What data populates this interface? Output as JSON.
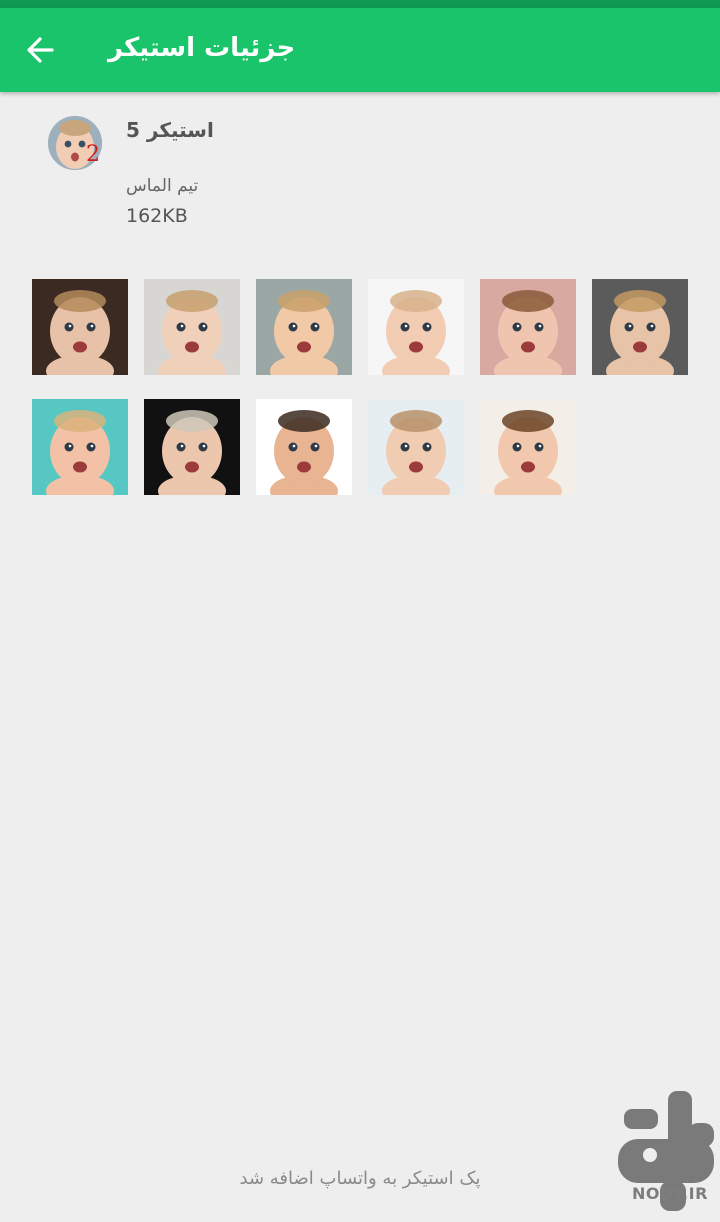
{
  "appbar": {
    "title": "جزئیات استیکر",
    "back_icon": "arrow-left-icon",
    "color": "#19c46a"
  },
  "pack": {
    "icon_badge": "2",
    "name": "استیکر 5",
    "publisher": "تیم الماس",
    "size": "162KB"
  },
  "stickers": [
    {
      "bg": "#3a2a22",
      "skin": "#e8c2a8",
      "hair": "#b48a5a"
    },
    {
      "bg": "#d8d6d2",
      "skin": "#f0d0b8",
      "hair": "#c8a070"
    },
    {
      "bg": "#9aa7a4",
      "skin": "#f1c9a6",
      "hair": "#c9a06a"
    },
    {
      "bg": "#f6f6f6",
      "skin": "#f2cdb4",
      "hair": "#d7b28a"
    },
    {
      "bg": "#d8a9a0",
      "skin": "#f0c5b0",
      "hair": "#8a5a3a"
    },
    {
      "bg": "#5b5b5b",
      "skin": "#e7c3a7",
      "hair": "#c49a63"
    },
    {
      "bg": "#56c7c2",
      "skin": "#f3c2a6",
      "hair": "#d9b27d"
    },
    {
      "bg": "#111111",
      "skin": "#ecc7ad",
      "hair": "#cfc7b8"
    },
    {
      "bg": "#ffffff",
      "skin": "#e9b491",
      "hair": "#3b2a20"
    },
    {
      "bg": "#e7eef2",
      "skin": "#f0cdb2",
      "hair": "#b9906a"
    },
    {
      "bg": "#f3efe8",
      "skin": "#f1c8ad",
      "hair": "#6b4426"
    }
  ],
  "footer_note": "پک استیکر به واتساپ اضافه شد",
  "watermark": {
    "icon": "nody-logo-icon",
    "text": "NODY.IR"
  }
}
